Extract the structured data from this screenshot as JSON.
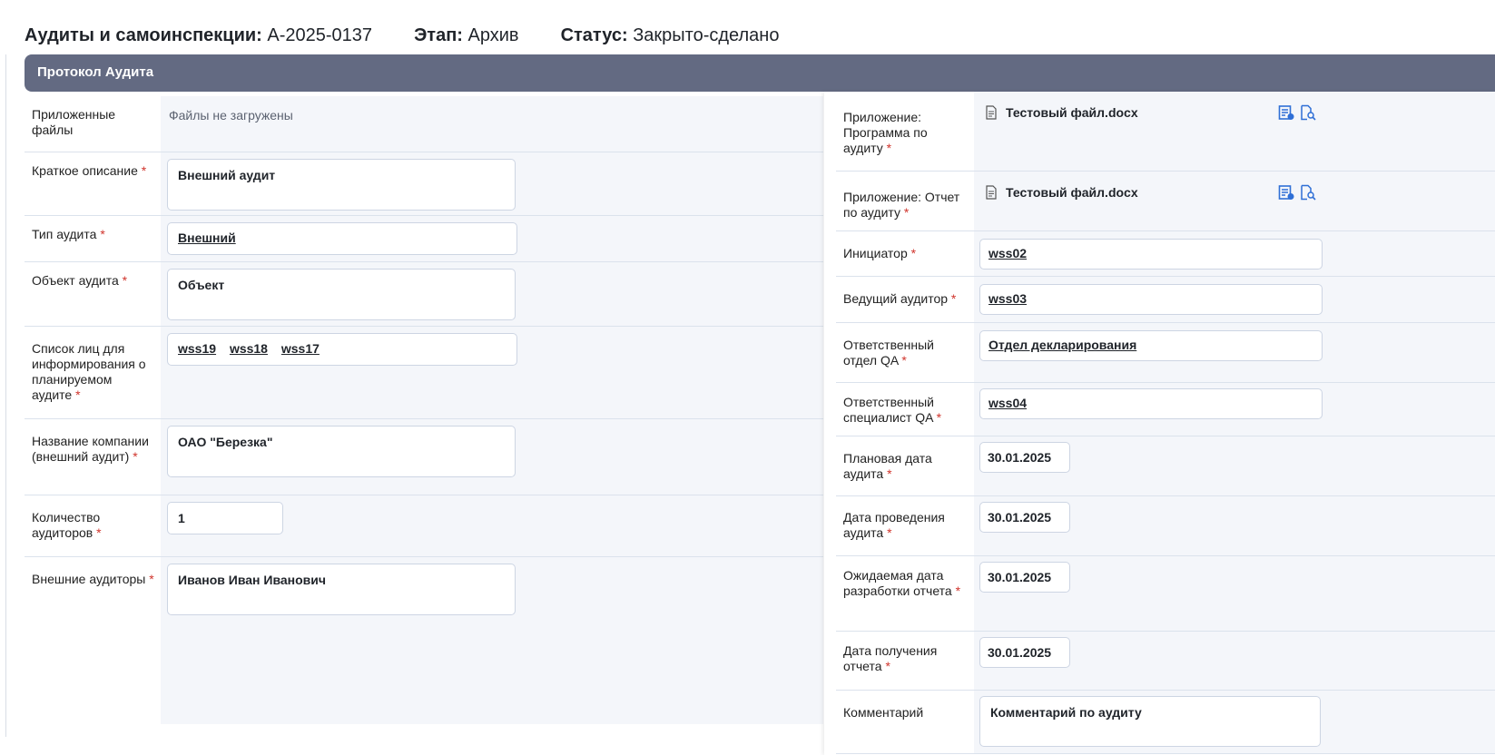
{
  "header": {
    "doc_label": "Аудиты и самоинспекции:",
    "doc_number": "A-2025-0137",
    "stage_label": "Этап:",
    "stage_value": "Архив",
    "status_label": "Статус:",
    "status_value": "Закрыто-сделано"
  },
  "section": {
    "title": "Протокол Аудита"
  },
  "left": {
    "attached": {
      "label": "Приложенные файлы",
      "value": "Файлы не загружены"
    },
    "short_desc": {
      "label": "Краткое описание",
      "value": "Внешний аудит"
    },
    "audit_type": {
      "label": "Тип аудита",
      "value": "Внешний"
    },
    "audit_object": {
      "label": "Объект аудита",
      "value": "Объект"
    },
    "notify_list": {
      "label": "Список лиц для информирования о планируемом аудите",
      "items": [
        "wss19",
        "wss18",
        "wss17"
      ]
    },
    "company": {
      "label": "Название компании (внешний аудит)",
      "value": "ОАО \"Березка\""
    },
    "auditors_count": {
      "label": "Количество аудиторов",
      "value": "1"
    },
    "external_auditors": {
      "label": "Внешние аудиторы",
      "value": "Иванов Иван Иванович"
    }
  },
  "right": {
    "program": {
      "label": "Приложение: Программа по аудиту",
      "file": "Тестовый файл.docx"
    },
    "report": {
      "label": "Приложение: Отчет по аудиту",
      "file": "Тестовый файл.docx"
    },
    "initiator": {
      "label": "Инициатор",
      "value": "wss02"
    },
    "lead_auditor": {
      "label": "Ведущий аудитор",
      "value": "wss03"
    },
    "qa_dept": {
      "label": "Ответственный отдел QA",
      "value": "Отдел декларирования"
    },
    "qa_specialist": {
      "label": "Ответственный специалист QA",
      "value": "wss04"
    },
    "planned_date": {
      "label": "Плановая дата аудита",
      "value": "30.01.2025"
    },
    "audit_date": {
      "label": "Дата проведения аудита",
      "value": "30.01.2025"
    },
    "expected_report_date": {
      "label": "Ожидаемая дата разработки отчета",
      "value": "30.01.2025"
    },
    "report_received_date": {
      "label": "Дата получения отчета",
      "value": "30.01.2025"
    },
    "comment": {
      "label": "Комментарий",
      "value": "Комментарий по аудиту"
    }
  },
  "required_mark": "*",
  "colors": {
    "title_bar": "#636a82",
    "required": "#d0342c",
    "field_bg": "#f4f6fa",
    "icon": "#2f6fd6"
  }
}
